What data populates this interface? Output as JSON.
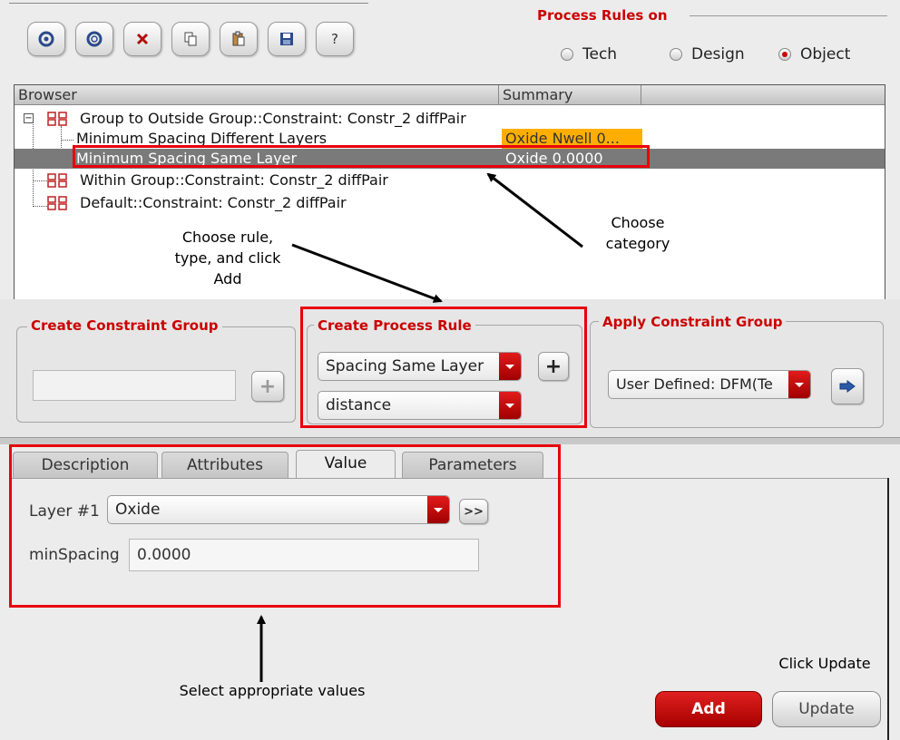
{
  "process_rules": {
    "title": "Process Rules on",
    "options": [
      "Tech",
      "Design",
      "Object"
    ],
    "selected": "Object"
  },
  "toolbar": {
    "icons": [
      "refresh-icon",
      "refresh-alt-icon",
      "delete-icon",
      "copy-icon",
      "paste-icon",
      "save-icon",
      "help-icon"
    ],
    "help_label": "?"
  },
  "browser": {
    "columns": [
      "Browser",
      "Summary"
    ],
    "rows": [
      {
        "label": "Group to Outside Group::Constraint: Constr_2 diffPair",
        "summary": ""
      },
      {
        "label": "Minimum Spacing Different Layers",
        "summary": "Oxide Nwell 0..."
      },
      {
        "label": "Minimum Spacing Same Layer",
        "summary": "Oxide 0.0000"
      },
      {
        "label": "Within Group::Constraint: Constr_2 diffPair",
        "summary": ""
      },
      {
        "label": "Default::Constraint: Constr_2 diffPair",
        "summary": ""
      }
    ],
    "expander_symbol": "−"
  },
  "annotations": {
    "choose_category": "Choose\ncategory",
    "choose_rule": "Choose rule,\ntype, and click\nAdd",
    "select_values": "Select appropriate values",
    "click_update": "Click Update"
  },
  "create_constraint_group": {
    "title": "Create Constraint Group",
    "value": ""
  },
  "create_process_rule": {
    "title": "Create Process Rule",
    "rule": "Spacing Same Layer",
    "type": "distance"
  },
  "apply_constraint_group": {
    "title": "Apply Constraint Group",
    "value": "User Defined: DFM(Te"
  },
  "tabs": [
    "Description",
    "Attributes",
    "Value",
    "Parameters"
  ],
  "active_tab": "Value",
  "value_panel": {
    "layer_label": "Layer #1",
    "layer_value": "Oxide",
    "more_label": ">>",
    "min_spacing_label": "minSpacing",
    "min_spacing_value": "0.0000"
  },
  "buttons": {
    "add": "Add",
    "update": "Update",
    "plus": "+"
  },
  "colors": {
    "accent_red": "#cc0000",
    "highlight_orange": "#ffae00",
    "selection_gray": "#7a7a7a",
    "annotation_red": "#e8000b"
  }
}
